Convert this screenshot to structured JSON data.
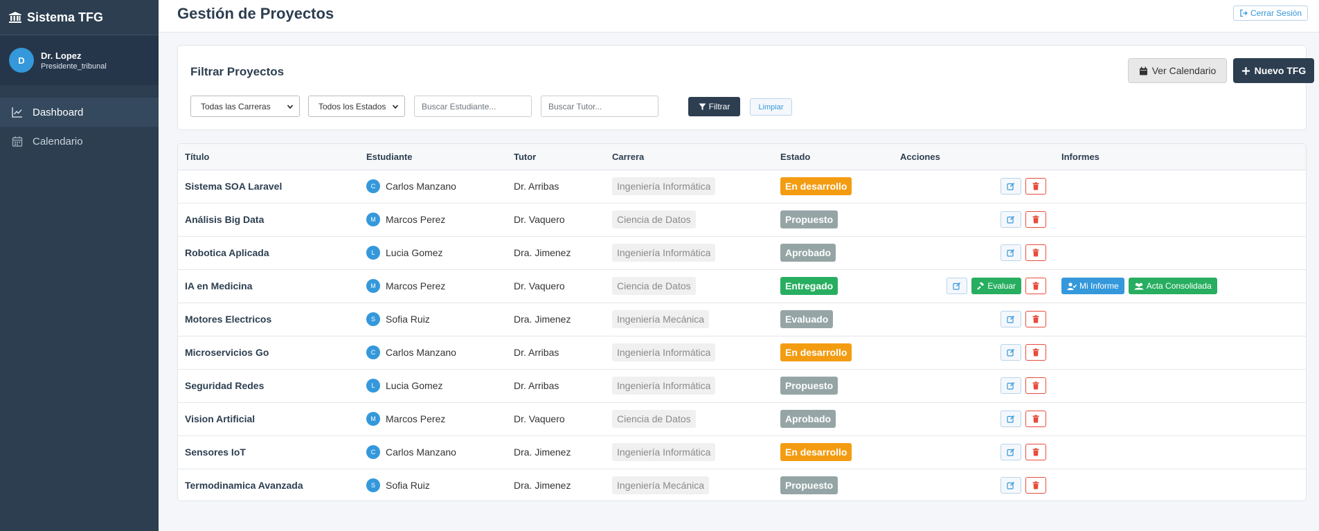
{
  "colors": {
    "sidebar_bg": "#2c3e50",
    "accent": "#3498db",
    "primary_dark": "#2c3e50",
    "danger": "#e74c3c",
    "success": "#27ae60"
  },
  "sidebar": {
    "brand": "Sistema TFG",
    "brand_icon": "bank-icon",
    "user": {
      "initial": "D",
      "name": "Dr. Lopez",
      "role": "Presidente_tribunal"
    },
    "items": [
      {
        "label": "Dashboard",
        "icon": "chart-line-icon",
        "active": true
      },
      {
        "label": "Calendario",
        "icon": "calendar-icon",
        "active": false
      }
    ]
  },
  "header": {
    "title": "Gestión de Proyectos",
    "logout_label": "Cerrar Sesión"
  },
  "filters": {
    "title": "Filtrar Proyectos",
    "calendar_btn": "Ver Calendario",
    "new_btn": "Nuevo TFG",
    "career_select": "Todas las Carreras",
    "status_select": "Todos los Estados",
    "student_placeholder": "Buscar Estudiante...",
    "tutor_placeholder": "Buscar Tutor...",
    "filter_btn": "Filtrar",
    "clear_btn": "Limpiar"
  },
  "table": {
    "headers": [
      "Título",
      "Estudiante",
      "Tutor",
      "Carrera",
      "Estado",
      "Acciones",
      "Informes"
    ],
    "eval_label": "Evaluar",
    "my_report_label": "Mi Informe",
    "consolidated_label": "Acta Consolidada",
    "status_colors": {
      "En desarrollo": "#f39c12",
      "Propuesto": "#95a5a6",
      "Aprobado": "#95a5a6",
      "Entregado": "#27ae60",
      "Evaluado": "#95a5a6"
    },
    "rows": [
      {
        "titulo": "Sistema SOA Laravel",
        "initial": "C",
        "estudiante": "Carlos Manzano",
        "tutor": "Dr. Arribas",
        "carrera": "Ingeniería Informática",
        "estado": "En desarrollo",
        "evaluable": false
      },
      {
        "titulo": "Análisis Big Data",
        "initial": "M",
        "estudiante": "Marcos Perez",
        "tutor": "Dr. Vaquero",
        "carrera": "Ciencia de Datos",
        "estado": "Propuesto",
        "evaluable": false
      },
      {
        "titulo": "Robotica Aplicada",
        "initial": "L",
        "estudiante": "Lucia Gomez",
        "tutor": "Dra. Jimenez",
        "carrera": "Ingeniería Informática",
        "estado": "Aprobado",
        "evaluable": false
      },
      {
        "titulo": "IA en Medicina",
        "initial": "M",
        "estudiante": "Marcos Perez",
        "tutor": "Dr. Vaquero",
        "carrera": "Ciencia de Datos",
        "estado": "Entregado",
        "evaluable": true
      },
      {
        "titulo": "Motores Electricos",
        "initial": "S",
        "estudiante": "Sofia Ruiz",
        "tutor": "Dra. Jimenez",
        "carrera": "Ingeniería Mecánica",
        "estado": "Evaluado",
        "evaluable": false
      },
      {
        "titulo": "Microservicios Go",
        "initial": "C",
        "estudiante": "Carlos Manzano",
        "tutor": "Dr. Arribas",
        "carrera": "Ingeniería Informática",
        "estado": "En desarrollo",
        "evaluable": false
      },
      {
        "titulo": "Seguridad Redes",
        "initial": "L",
        "estudiante": "Lucia Gomez",
        "tutor": "Dr. Arribas",
        "carrera": "Ingeniería Informática",
        "estado": "Propuesto",
        "evaluable": false
      },
      {
        "titulo": "Vision Artificial",
        "initial": "M",
        "estudiante": "Marcos Perez",
        "tutor": "Dr. Vaquero",
        "carrera": "Ciencia de Datos",
        "estado": "Aprobado",
        "evaluable": false
      },
      {
        "titulo": "Sensores IoT",
        "initial": "C",
        "estudiante": "Carlos Manzano",
        "tutor": "Dra. Jimenez",
        "carrera": "Ingeniería Informática",
        "estado": "En desarrollo",
        "evaluable": false
      },
      {
        "titulo": "Termodinamica Avanzada",
        "initial": "S",
        "estudiante": "Sofia Ruiz",
        "tutor": "Dra. Jimenez",
        "carrera": "Ingeniería Mecánica",
        "estado": "Propuesto",
        "evaluable": false
      }
    ]
  }
}
